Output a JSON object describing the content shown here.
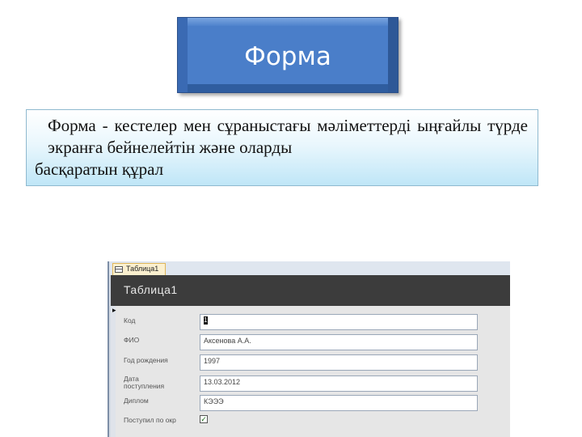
{
  "slide": {
    "title": "Форма",
    "definition_line1": "Форма    - кестелер мен сұраныстағы мәліметтерді ыңғайлы түрде экранға бейнелейтін және оларды",
    "definition_line2": "басқаратын құрал"
  },
  "access_form": {
    "tab_label": "Таблица1",
    "header_title": "Таблица1",
    "record_selector": "▸",
    "fields": [
      {
        "label": "Код",
        "value": "1"
      },
      {
        "label": "ФИО",
        "value": "Аксенова А.А."
      },
      {
        "label": "Год рождения",
        "value": "1997"
      },
      {
        "label": "Дата поступления",
        "value": "13.03.2012"
      },
      {
        "label": "Диплом",
        "value": "КЭЭЭ"
      },
      {
        "label": "Поступил по окр",
        "value": "✓"
      }
    ],
    "spin_up": "▲",
    "spin_down": "▼"
  }
}
